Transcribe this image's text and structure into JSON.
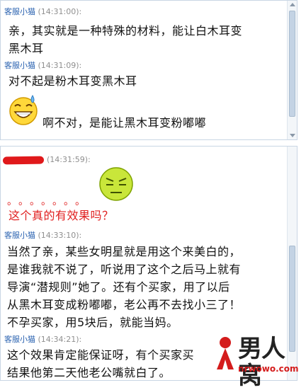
{
  "messages_top": [
    {
      "sender": "客服小猫",
      "time": "(14:31:00):",
      "lines": [
        "亲，其实就是一种特殊的材料，能让白木耳变",
        "黑木耳"
      ]
    },
    {
      "sender": "客服小猫",
      "time": "(14:31:09):",
      "lines": [
        "对不起是粉木耳变黑木耳"
      ]
    },
    {
      "emoji": "laughing-sweat-emoji",
      "text": "啊不对，是能让黑木耳变粉嘟嘟"
    }
  ],
  "messages_bottom": [
    {
      "sender": "",
      "time": "(14:31:59):",
      "dots": "。。。。。。。",
      "line": "这个真的有效果吗？"
    },
    {
      "sender": "客服小猫",
      "time": "(14:33:10):",
      "lines": [
        "当然了亲，某些女明星就是用这个来美白的，",
        "是谁我就不说了，听说用了这个之后马上就有",
        "导演“潜规则”她了。还有个买家，用了以后",
        "从黑木耳变成粉嘟嘟，老公再不去找小三了！",
        "不孕买家，用5块后，就能当妈。"
      ]
    },
    {
      "sender": "客服小猫",
      "time": "(14:34:21):",
      "lines": [
        "这个效果肯定能保证呀，有个买家买",
        "结果他第二天他老公嘴就白了。"
      ]
    }
  ],
  "watermark": {
    "brand": "男人窝",
    "url": "nrwowo.com"
  },
  "colors": {
    "sender": "#2a62b0",
    "time": "#8f8f8f",
    "red_text": "#e02020",
    "border": "#c9d6e4"
  }
}
